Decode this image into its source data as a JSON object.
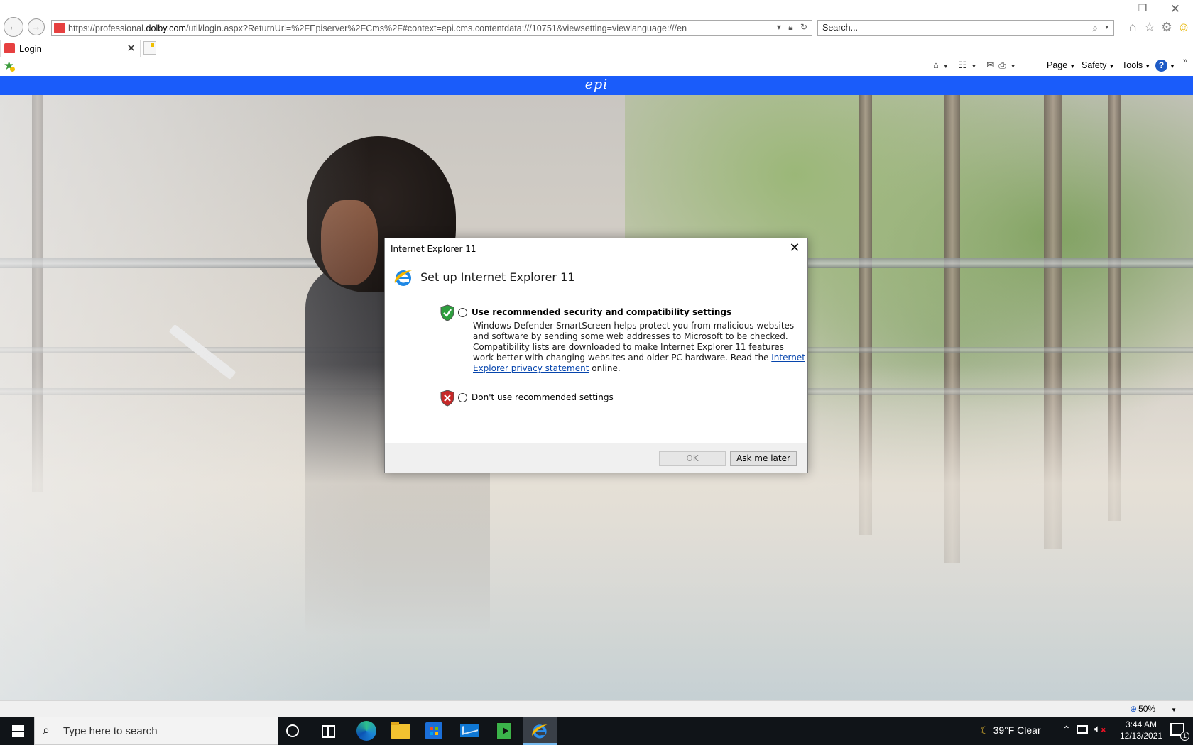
{
  "browser": {
    "address": {
      "url_prefix": "https://professional.",
      "url_domain": "dolby.com",
      "url_rest": "/util/login.aspx?ReturnUrl=%2FEpiserver%2FCms%2F#context=epi.cms.contentdata:///10751&viewsetting=viewlanguage:///en"
    },
    "search": {
      "placeholder": "Search..."
    },
    "tab": {
      "title": "Login"
    },
    "command_bar": {
      "page_label": "Page",
      "safety_label": "Safety",
      "tools_label": "Tools"
    },
    "icons": [
      "back-icon",
      "forward-icon",
      "dropdown-icon",
      "lock-icon",
      "refresh-icon",
      "search-icon",
      "home-icon",
      "favorites-star-icon",
      "settings-gear-icon",
      "smiley-feedback-icon",
      "feeds-icon",
      "read-mail-icon",
      "print-icon",
      "help-icon"
    ]
  },
  "page": {
    "brand_logo_text": "epi",
    "brand_color": "#1a5cfa"
  },
  "dialog": {
    "title": "Internet Explorer 11",
    "heading": "Set up Internet Explorer 11",
    "option_recommended": {
      "label": "Use recommended security and compatibility settings",
      "description_start": "Windows Defender SmartScreen helps protect you from malicious websites and software by sending some web addresses to Microsoft to be checked. Compatibility lists are downloaded to make Internet Explorer 11 features work better with changing websites and older PC hardware. Read the ",
      "link_text": "Internet Explorer privacy statement",
      "description_end": " online.",
      "selected": false
    },
    "option_not_recommended": {
      "label": "Don't use recommended settings",
      "selected": false
    },
    "buttons": {
      "ok": "OK",
      "ok_enabled": false,
      "ask_later": "Ask me later"
    }
  },
  "statusbar": {
    "zoom": "50%"
  },
  "taskbar": {
    "search_placeholder": "Type here to search",
    "weather": "39°F  Clear",
    "time": "3:44 AM",
    "date": "12/13/2021",
    "notification_count": "1",
    "pinned_apps": [
      "edge",
      "file-explorer",
      "microsoft-store",
      "mail",
      "media-player",
      "internet-explorer"
    ]
  }
}
